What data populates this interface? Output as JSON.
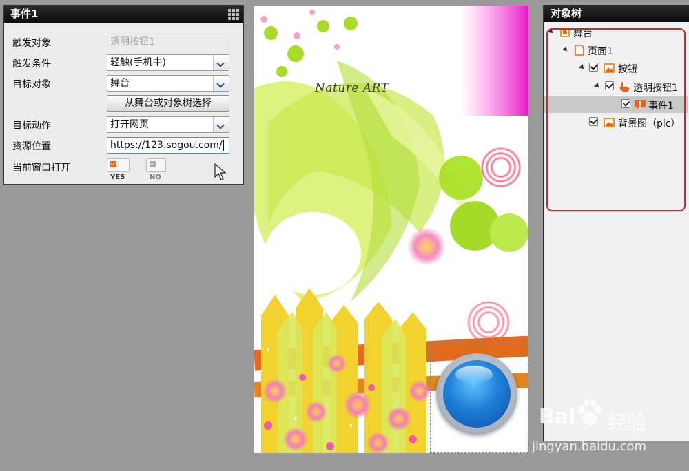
{
  "event_panel": {
    "title": "事件1",
    "rows": {
      "trigger_object": {
        "label": "触发对象",
        "value": "透明按钮1"
      },
      "trigger_condition": {
        "label": "触发条件",
        "value": "轻触(手机中)"
      },
      "target_object": {
        "label": "目标对象",
        "value": "舞台",
        "choose_button": "从舞台或对象树选择"
      },
      "target_action": {
        "label": "目标动作",
        "value": "打开网页"
      },
      "resource_location": {
        "label": "资源位置",
        "value": "https://123.sogou.com/"
      },
      "open_current_window": {
        "label": "当前窗口打开",
        "yes": "YES",
        "no": "NO",
        "selected": "YES"
      }
    }
  },
  "stage": {
    "title": "Nature ART"
  },
  "object_tree": {
    "title": "对象树",
    "nodes": [
      {
        "label": "舞台",
        "level": 0,
        "checkbox": false,
        "icon": "stage-icon",
        "expanded": true
      },
      {
        "label": "页面1",
        "level": 1,
        "checkbox": false,
        "icon": "page-icon",
        "expanded": true
      },
      {
        "label": "按钮",
        "level": 2,
        "checkbox": true,
        "icon": "image-icon",
        "expanded": true
      },
      {
        "label": "透明按钮1",
        "level": 3,
        "checkbox": true,
        "icon": "hand-icon",
        "expanded": true
      },
      {
        "label": "事件1",
        "level": 4,
        "checkbox": true,
        "icon": "event-icon",
        "selected": true
      },
      {
        "label": "背景图（pic）",
        "level": 2,
        "checkbox": true,
        "icon": "image-icon"
      }
    ]
  },
  "watermark": {
    "brand": "Bai",
    "brand2": "经验",
    "url": "jingyan.baidu.com"
  },
  "colors": {
    "accent": "#e8641e",
    "highlight": "#d9232c",
    "selected_row": "#c9c9c9"
  }
}
